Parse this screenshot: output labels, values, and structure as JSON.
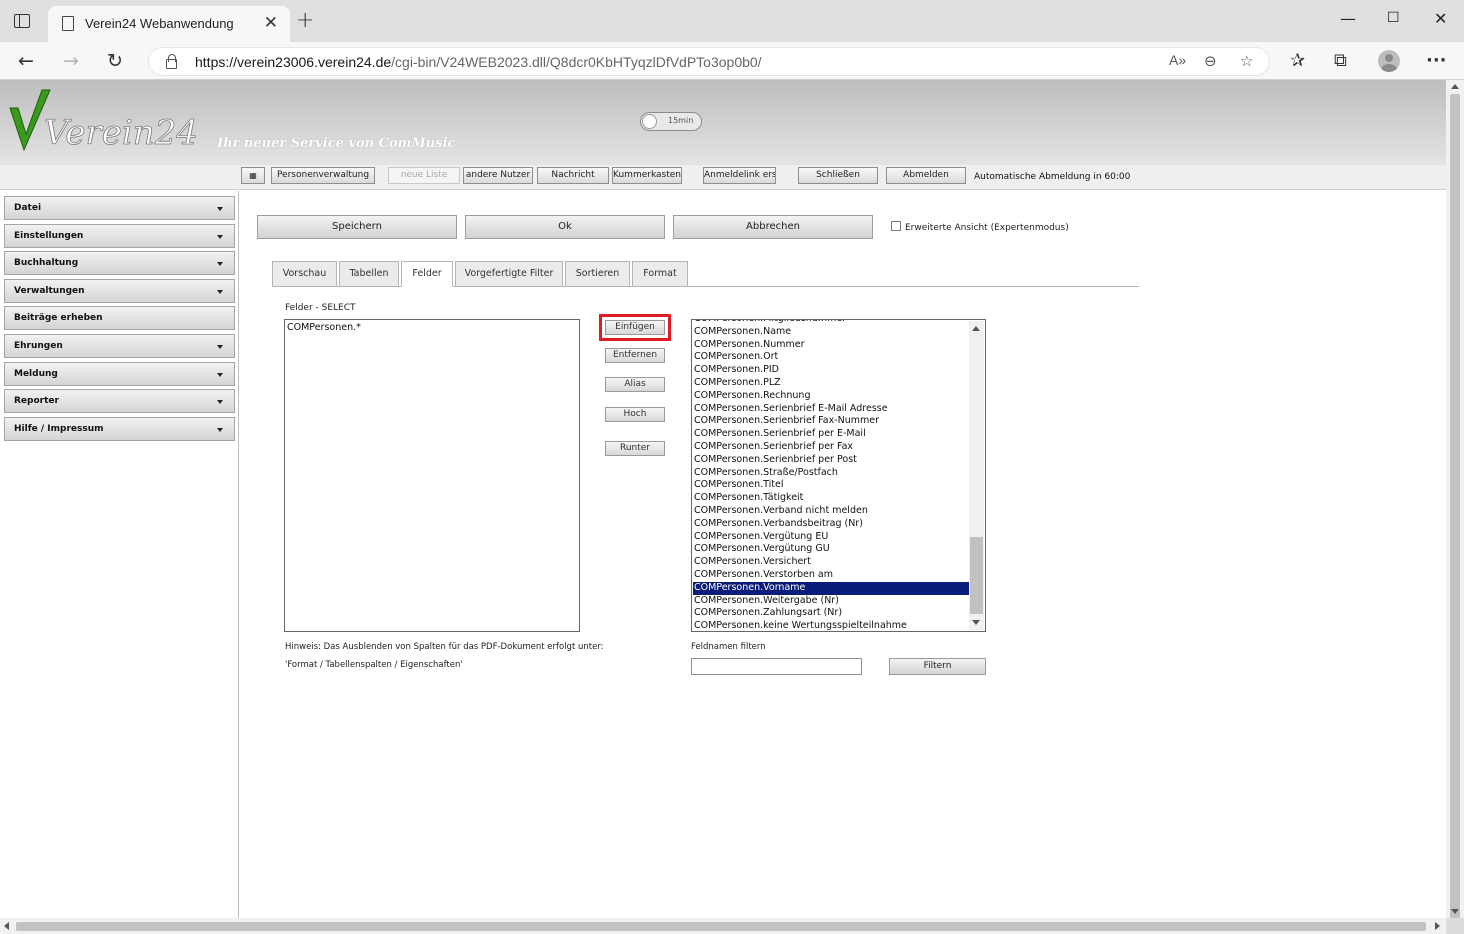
{
  "browser": {
    "tab_title": "Verein24 Webanwendung",
    "url_host": "https://verein23006.verein24.de",
    "url_path": "/cgi-bin/V24WEB2023.dll/Q8dcr0KbHTyqzlDfVdPTo3op0b0/"
  },
  "header": {
    "logo_text": "Verein24",
    "slogan": "Ihr neuer Service von ComMusic",
    "timer_label": "15min"
  },
  "toolbar": {
    "items": [
      {
        "label": "Personenverwaltung"
      },
      {
        "label": "neue Liste"
      },
      {
        "label": "andere Nutzer"
      },
      {
        "label": "Nachricht"
      },
      {
        "label": "Kummerkasten"
      },
      {
        "label": "Anmeldelink erst"
      },
      {
        "label": "Schließen"
      },
      {
        "label": "Abmelden"
      }
    ],
    "auto_logout": "Automatische Abmeldung in 60:00"
  },
  "sidebar": {
    "items": [
      {
        "label": "Datei"
      },
      {
        "label": "Einstellungen"
      },
      {
        "label": "Buchhaltung"
      },
      {
        "label": "Verwaltungen"
      },
      {
        "label": "Beiträge erheben"
      },
      {
        "label": "Ehrungen"
      },
      {
        "label": "Meldung"
      },
      {
        "label": "Reporter"
      },
      {
        "label": "Hilfe / Impressum"
      }
    ]
  },
  "actions": {
    "save": "Speichern",
    "ok": "Ok",
    "cancel": "Abbrechen",
    "expert_mode": "Erweiterte Ansicht (Expertenmodus)"
  },
  "tabs": [
    {
      "label": "Vorschau"
    },
    {
      "label": "Tabellen"
    },
    {
      "label": "Felder"
    },
    {
      "label": "Vorgefertigte Filter"
    },
    {
      "label": "Sortieren"
    },
    {
      "label": "Format"
    }
  ],
  "fields": {
    "select_label": "Felder - SELECT",
    "selected_items": [
      "COMPersonen.*"
    ],
    "buttons": {
      "insert": "Einfügen",
      "remove": "Entfernen",
      "alias": "Alias",
      "up": "Hoch",
      "down": "Runter"
    },
    "available": [
      "COMPersonen.Mitgliedsnummer",
      "COMPersonen.Name",
      "COMPersonen.Nummer",
      "COMPersonen.Ort",
      "COMPersonen.PID",
      "COMPersonen.PLZ",
      "COMPersonen.Rechnung",
      "COMPersonen.Serienbrief E-Mail Adresse",
      "COMPersonen.Serienbrief Fax-Nummer",
      "COMPersonen.Serienbrief per E-Mail",
      "COMPersonen.Serienbrief per Fax",
      "COMPersonen.Serienbrief per Post",
      "COMPersonen.Straße/Postfach",
      "COMPersonen.Titel",
      "COMPersonen.Tätigkeit",
      "COMPersonen.Verband nicht melden",
      "COMPersonen.Verbandsbeitrag (Nr)",
      "COMPersonen.Vergütung EU",
      "COMPersonen.Vergütung GU",
      "COMPersonen.Versichert",
      "COMPersonen.Verstorben am",
      "COMPersonen.Vorname",
      "COMPersonen.Weitergabe (Nr)",
      "COMPersonen.Zahlungsart (Nr)",
      "COMPersonen.keine Wertungsspielteilnahme"
    ],
    "selected_available": "COMPersonen.Vorname",
    "hint_line1": "Hinweis: Das Ausblenden von Spalten für das PDF-Dokument erfolgt unter:",
    "hint_line2": "'Format / Tabellenspalten / Eigenschaften'",
    "filter_label": "Feldnamen filtern",
    "filter_value": "",
    "filter_button": "Filtern"
  },
  "colors": {
    "selection": "#0a1c7a",
    "highlight": "#e01b24",
    "logo_green": "#3a9a1e"
  }
}
